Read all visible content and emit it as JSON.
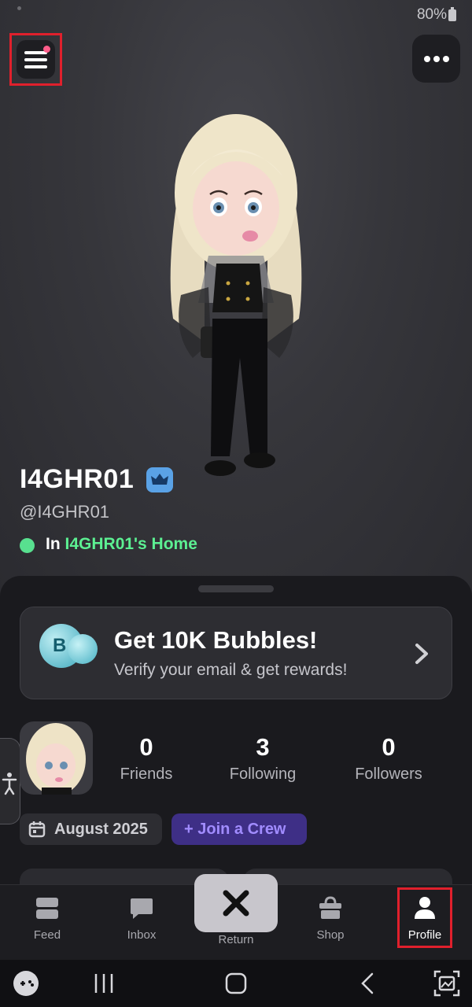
{
  "status_bar": {
    "battery": "80%"
  },
  "header": {
    "menu_icon": "hamburger-menu-icon",
    "more_icon": "more-options-icon"
  },
  "profile": {
    "display_name": "I4GHR01",
    "handle": "@I4GHR01",
    "location_prefix": "In",
    "location_name": "I4GHR01's Home",
    "badge_icon": "crown-icon",
    "online_color": "#58e08f"
  },
  "promo": {
    "title": "Get 10K Bubbles!",
    "subtitle": "Verify your email & get rewards!",
    "bubble_letter": "B"
  },
  "stats": [
    {
      "value": "0",
      "label": "Friends"
    },
    {
      "value": "3",
      "label": "Following"
    },
    {
      "value": "0",
      "label": "Followers"
    }
  ],
  "chips": {
    "joined": "August 2025",
    "crew": "+ Join a Crew"
  },
  "tabs": [
    {
      "label": "Feed",
      "icon": "feed-icon"
    },
    {
      "label": "Inbox",
      "icon": "inbox-icon"
    },
    {
      "label": "Return",
      "icon": "close-icon"
    },
    {
      "label": "Shop",
      "icon": "shop-icon"
    },
    {
      "label": "Profile",
      "icon": "profile-icon",
      "active": true
    }
  ],
  "colors": {
    "accent_green": "#5cf092",
    "crew_purple": "#a18cff",
    "highlight_red": "#e0202c"
  }
}
